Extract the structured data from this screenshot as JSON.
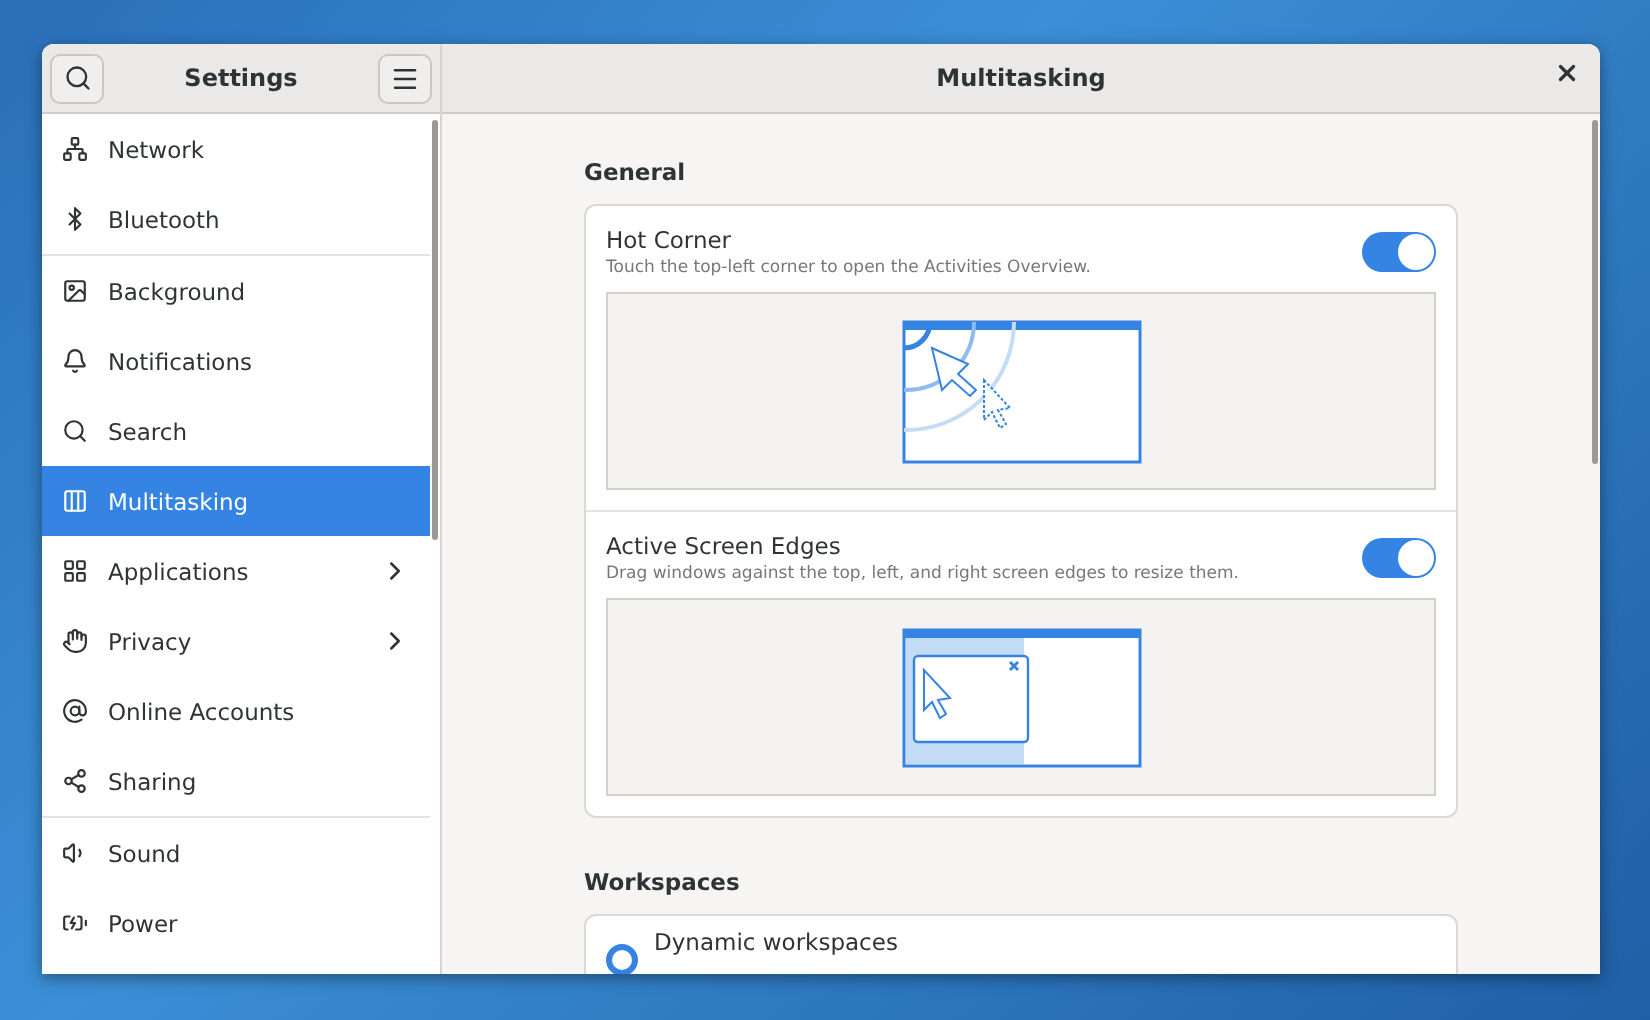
{
  "sidebar": {
    "title": "Settings",
    "groups": [
      {
        "items": [
          {
            "label": "Network",
            "selected": false,
            "has_submenu": false
          },
          {
            "label": "Bluetooth",
            "selected": false,
            "has_submenu": false
          }
        ]
      },
      {
        "items": [
          {
            "label": "Background",
            "selected": false,
            "has_submenu": false
          },
          {
            "label": "Notifications",
            "selected": false,
            "has_submenu": false
          },
          {
            "label": "Search",
            "selected": false,
            "has_submenu": false
          },
          {
            "label": "Multitasking",
            "selected": true,
            "has_submenu": false
          },
          {
            "label": "Applications",
            "selected": false,
            "has_submenu": true
          },
          {
            "label": "Privacy",
            "selected": false,
            "has_submenu": true
          },
          {
            "label": "Online Accounts",
            "selected": false,
            "has_submenu": false
          },
          {
            "label": "Sharing",
            "selected": false,
            "has_submenu": false
          }
        ]
      },
      {
        "items": [
          {
            "label": "Sound",
            "selected": false,
            "has_submenu": false
          },
          {
            "label": "Power",
            "selected": false,
            "has_submenu": false
          }
        ]
      }
    ]
  },
  "page": {
    "title": "Multitasking",
    "sections": [
      {
        "heading": "General",
        "rows": [
          {
            "kind": "toggle",
            "title": "Hot Corner",
            "subtitle": "Touch the top-left corner to open the Activities Overview.",
            "on": true
          },
          {
            "kind": "toggle",
            "title": "Active Screen Edges",
            "subtitle": "Drag windows against the top, left, and right screen edges to resize them.",
            "on": true
          }
        ]
      },
      {
        "heading": "Workspaces",
        "rows": [
          {
            "kind": "radio",
            "title": "Dynamic workspaces",
            "selected": true
          }
        ]
      }
    ]
  }
}
